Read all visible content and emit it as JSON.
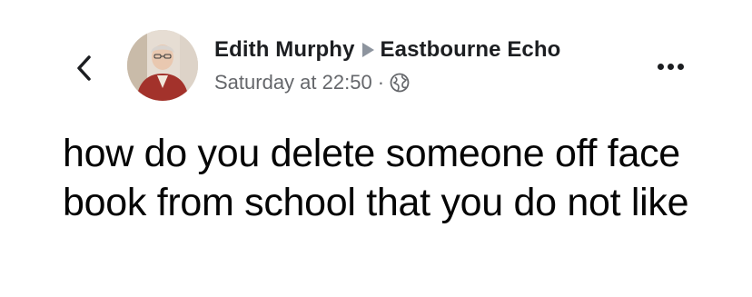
{
  "post": {
    "author_name": "Edith Murphy",
    "group_name": "Eastbourne Echo",
    "timestamp": "Saturday at 22:50",
    "separator": "·",
    "privacy_icon": "globe-icon",
    "text": "how do you delete someone off face book from school that you do not like"
  },
  "icons": {
    "back": "chevron-left-icon",
    "more": "more-dots-icon",
    "share_arrow": "triangle-right-icon"
  },
  "colors": {
    "text": "#1c1e21",
    "meta": "#65676b",
    "arrow": "#8d949e",
    "background": "#ffffff"
  }
}
